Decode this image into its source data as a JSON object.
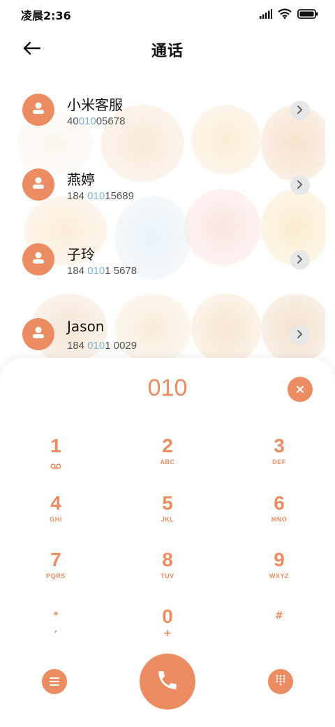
{
  "status_bar": {
    "time": "凌晨2:36"
  },
  "header": {
    "title": "通话"
  },
  "contacts": [
    {
      "name": "小米客服",
      "number_parts": [
        "40",
        "010",
        "05678"
      ],
      "highlight_index": 1
    },
    {
      "name": "燕婷",
      "number_parts": [
        "184 ",
        "010",
        "15689"
      ],
      "highlight_index": 1
    },
    {
      "name": "子玲",
      "number_parts": [
        "184 ",
        "010",
        "1 5678"
      ],
      "highlight_index": 1
    },
    {
      "name": "Jason",
      "number_parts": [
        "184 ",
        "010",
        "1 0029"
      ],
      "highlight_index": 1
    }
  ],
  "dialpad": {
    "input": "010",
    "keys": [
      {
        "digit": "1",
        "letters": ""
      },
      {
        "digit": "2",
        "letters": "ABC"
      },
      {
        "digit": "3",
        "letters": "DEF"
      },
      {
        "digit": "4",
        "letters": "GHI"
      },
      {
        "digit": "5",
        "letters": "JKL"
      },
      {
        "digit": "6",
        "letters": "MNO"
      },
      {
        "digit": "7",
        "letters": "PQRS"
      },
      {
        "digit": "8",
        "letters": "TUV"
      },
      {
        "digit": "9",
        "letters": "WXYZ"
      },
      {
        "digit": "*",
        "letters": ","
      },
      {
        "digit": "0",
        "letters": "+"
      },
      {
        "digit": "#",
        "letters": ""
      }
    ]
  },
  "colors": {
    "accent": "#ec8c62",
    "highlight_digits": "#7fb4d4"
  },
  "icons": {
    "back": "arrow-left-icon",
    "avatar": "person-icon",
    "chevron": "chevron-right-icon",
    "clear": "close-icon",
    "voicemail": "voicemail-icon",
    "menu": "menu-icon",
    "call": "phone-icon",
    "keypad": "dialpad-icon"
  }
}
